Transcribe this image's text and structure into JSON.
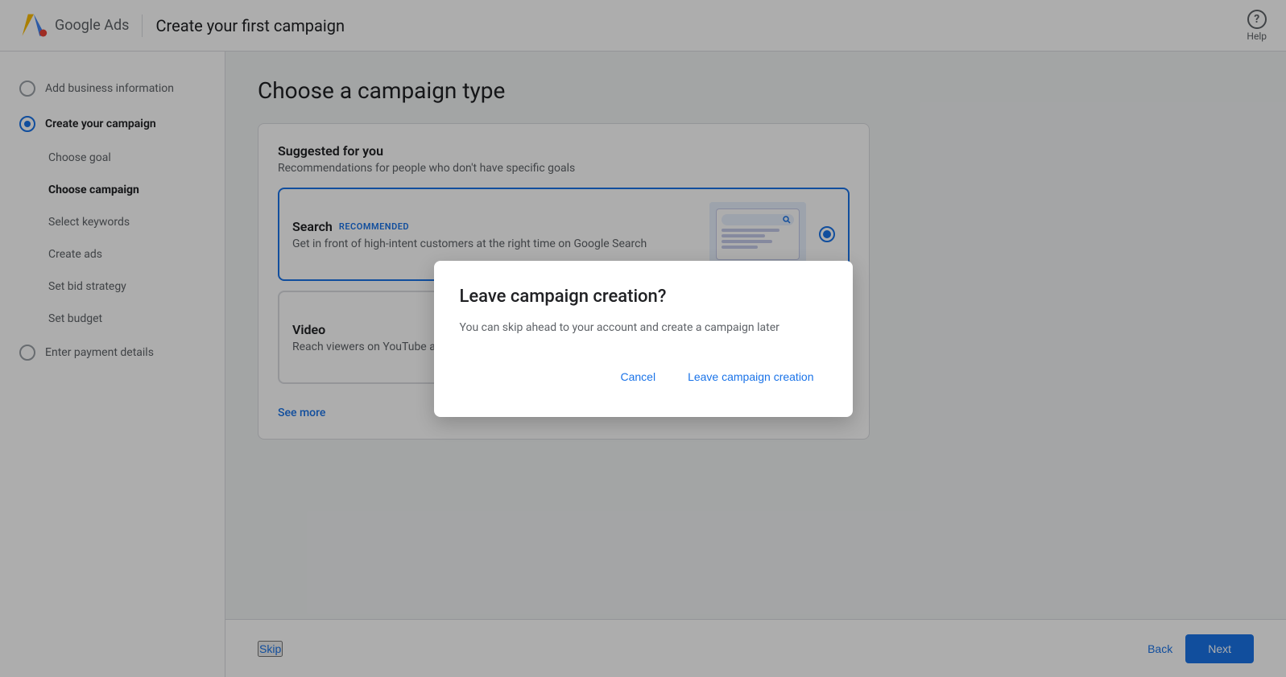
{
  "header": {
    "logo_text": "Google Ads",
    "title": "Create your first campaign",
    "help_label": "Help"
  },
  "sidebar": {
    "steps": [
      {
        "id": "add-business",
        "label": "Add business information",
        "type": "top",
        "state": "inactive"
      },
      {
        "id": "create-campaign",
        "label": "Create your campaign",
        "type": "top",
        "state": "active"
      },
      {
        "id": "choose-goal",
        "label": "Choose goal",
        "type": "sub",
        "state": "inactive"
      },
      {
        "id": "choose-campaign",
        "label": "Choose campaign",
        "type": "sub",
        "state": "active"
      },
      {
        "id": "select-keywords",
        "label": "Select keywords",
        "type": "sub",
        "state": "inactive"
      },
      {
        "id": "create-ads",
        "label": "Create ads",
        "type": "sub",
        "state": "inactive"
      },
      {
        "id": "set-bid",
        "label": "Set bid strategy",
        "type": "sub",
        "state": "inactive"
      },
      {
        "id": "set-budget",
        "label": "Set budget",
        "type": "sub",
        "state": "inactive"
      },
      {
        "id": "enter-payment",
        "label": "Enter payment details",
        "type": "top",
        "state": "inactive"
      }
    ]
  },
  "main": {
    "page_title": "Choose a campaign type",
    "suggested_title": "Suggested for you",
    "suggested_subtitle": "Recommendations for people who don't have specific goals",
    "campaign_options": [
      {
        "id": "search",
        "title": "Search",
        "badge": "RECOMMENDED",
        "description": "Get in front of high-intent customers at the right time on Google Search",
        "selected": true
      },
      {
        "id": "video",
        "title": "Video",
        "badge": "",
        "description": "Reach viewers on YouTube and across the web",
        "selected": false
      }
    ],
    "see_more_label": "See more"
  },
  "footer": {
    "skip_label": "Skip",
    "back_label": "Back",
    "next_label": "Next"
  },
  "dialog": {
    "title": "Leave campaign creation?",
    "body": "You can skip ahead to your account and create a campaign later",
    "cancel_label": "Cancel",
    "confirm_label": "Leave campaign creation"
  }
}
